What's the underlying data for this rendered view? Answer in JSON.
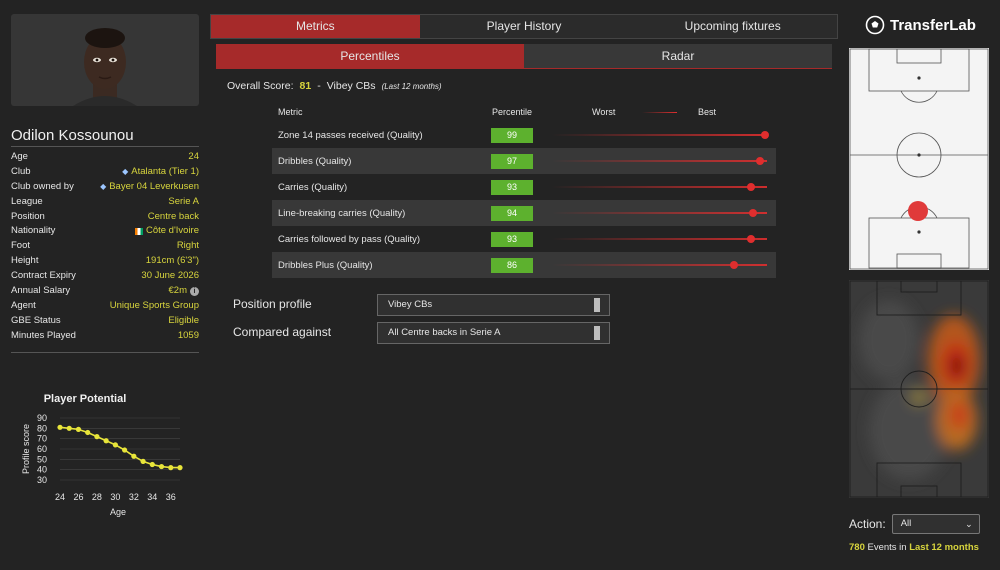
{
  "player": {
    "name": "Odilon Kossounou",
    "info": [
      {
        "label": "Age",
        "value": "24"
      },
      {
        "label": "Club",
        "value": "Atalanta (Tier 1)",
        "icon": "club-crest-icon"
      },
      {
        "label": "Club owned by",
        "value": "Bayer 04 Leverkusen",
        "icon": "club-crest-icon"
      },
      {
        "label": "League",
        "value": "Serie A"
      },
      {
        "label": "Position",
        "value": "Centre back"
      },
      {
        "label": "Nationality",
        "value": "Côte d'Ivoire",
        "icon": "flag-icon"
      },
      {
        "label": "Foot",
        "value": "Right"
      },
      {
        "label": "Height",
        "value": "191cm (6'3\")"
      },
      {
        "label": "Contract Expiry",
        "value": "30 June 2026"
      },
      {
        "label": "Annual Salary",
        "value": "€2m",
        "icon": "info-icon"
      },
      {
        "label": "Agent",
        "value": "Unique Sports Group"
      },
      {
        "label": "GBE Status",
        "value": "Eligible"
      },
      {
        "label": "Minutes Played",
        "value": "1059"
      }
    ]
  },
  "tabs": [
    "Metrics",
    "Player History",
    "Upcoming fixtures"
  ],
  "subtabs": [
    "Percentiles",
    "Radar"
  ],
  "overall": {
    "label": "Overall Score:",
    "score": "81",
    "sep": "-",
    "profile": "Vibey CBs",
    "period": "(Last 12 months)"
  },
  "metrics_header": {
    "metric": "Metric",
    "percentile": "Percentile",
    "worst": "Worst",
    "best": "Best"
  },
  "metrics": [
    {
      "name": "Zone 14 passes received (Quality)",
      "percentile": 99
    },
    {
      "name": "Dribbles (Quality)",
      "percentile": 97
    },
    {
      "name": "Carries (Quality)",
      "percentile": 93
    },
    {
      "name": "Line-breaking carries (Quality)",
      "percentile": 94
    },
    {
      "name": "Carries followed by pass (Quality)",
      "percentile": 93
    },
    {
      "name": "Dribbles Plus (Quality)",
      "percentile": 86
    }
  ],
  "selectors": {
    "position_profile_label": "Position profile",
    "position_profile_value": "Vibey CBs",
    "compared_label": "Compared against",
    "compared_value": "All Centre backs in Serie A"
  },
  "chart_data": {
    "type": "line",
    "title": "Player Potential",
    "xlabel": "Age",
    "ylabel": "Profile score",
    "x": [
      24,
      25,
      26,
      27,
      28,
      29,
      30,
      31,
      32,
      33,
      34,
      35,
      36,
      37
    ],
    "values": [
      81,
      80,
      79,
      76,
      72,
      68,
      64,
      59,
      53,
      48,
      45,
      43,
      42,
      42
    ],
    "xticks": [
      24,
      26,
      28,
      30,
      32,
      34,
      36
    ],
    "yticks": [
      30,
      40,
      50,
      60,
      70,
      80,
      90
    ],
    "xlim": [
      24,
      37
    ],
    "ylim": [
      30,
      90
    ],
    "line_color": "#e8e53a",
    "grid": true
  },
  "right": {
    "brand": "TransferLab",
    "action_label": "Action:",
    "action_value": "All",
    "events_count": "780",
    "events_text": "Events in",
    "events_period": "Last 12 months"
  },
  "colors": {
    "accent": "#a62a2a",
    "highlight": "#d7d43d",
    "pct_green": "#5db12e",
    "dot_red": "#e02e2e"
  }
}
